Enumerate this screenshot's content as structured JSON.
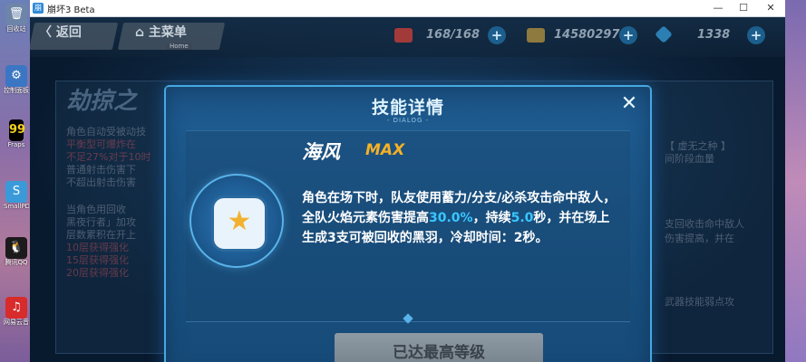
{
  "desktop": {
    "icons": [
      {
        "label": "回收站",
        "color": "#6d85a8",
        "glyph": "🗑"
      },
      {
        "label": "控制面板",
        "color": "#3b76c4",
        "glyph": "⚙"
      },
      {
        "label": "Fraps",
        "color": "#f5d21c",
        "glyph": "99"
      },
      {
        "label": "SmallPDF",
        "color": "#3a9ad9",
        "glyph": "S"
      },
      {
        "label": "腾讯QQ",
        "color": "#1b1b1b",
        "glyph": "🐧"
      },
      {
        "label": "网易云音乐",
        "color": "#d82b2b",
        "glyph": "♫"
      }
    ]
  },
  "window": {
    "title": "崩坏3 Beta",
    "minimize": "—",
    "maximize": "☐",
    "close": "✕"
  },
  "topbar": {
    "back_label": "返回",
    "home_label": "主菜单",
    "home_sub": "Home",
    "stamina": "168/168",
    "coins": "14580297",
    "crystals": "1338",
    "plus": "+",
    "colors": {
      "stamina": "#c0392b",
      "coins": "#b8902a",
      "crystals": "#3aa0d8"
    }
  },
  "background": {
    "title": "劫掠之",
    "lines_left": [
      "角色自动受被动技",
      "平衡型可爆炸在",
      "不足27%对于10时",
      "普通射击伤害下",
      "不超出射击伤害",
      "当角色用回收",
      "黑夜行者」加攻",
      "层数累积在开上",
      "10层获得强化",
      "15层获得强化",
      "20层获得强化"
    ],
    "lines_right": [
      "【 虚无之种 】",
      "间阶段血量",
      "支回收击命中敌人",
      "伤害提高，并在",
      "武器技能弱点攻"
    ]
  },
  "dialog": {
    "title": "技能详情",
    "subtitle": "- DIALOG -",
    "close_icon": "✕",
    "skill_name": "海风",
    "skill_level": "MAX",
    "desc_part1": "角色在场下时，队友使用蓄力/分支/必杀攻击命中敌人，全队火焰元素伤害提高",
    "desc_value1": "30.0%",
    "desc_part2": "，持续",
    "desc_value2": "5.0",
    "desc_part3": "秒，并在场上生成3支可被回收的黑羽，冷却时间：2秒。",
    "button_label": "已达最高等级",
    "highlight_color": "#39c6ff",
    "level_color": "#f5b126"
  }
}
